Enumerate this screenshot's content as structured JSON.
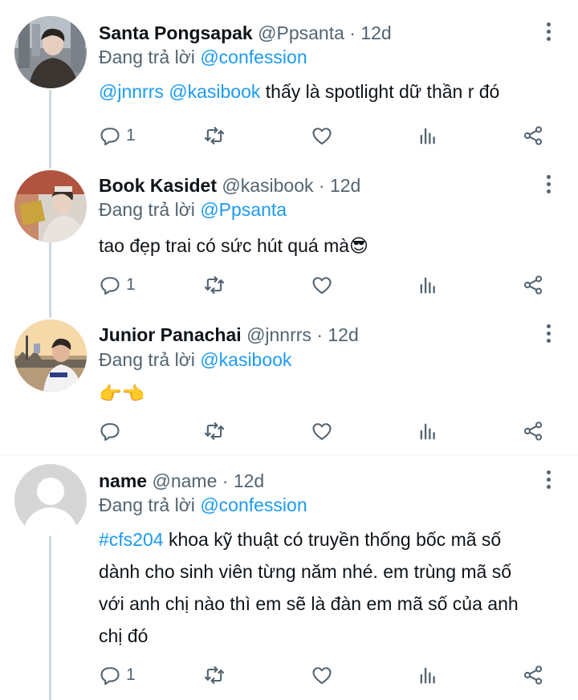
{
  "tweets": [
    {
      "name": "Santa Pongsapak",
      "handle": "@Ppsanta",
      "sep": "·",
      "time": "12d",
      "reply_prefix": "Đang trả lời",
      "reply_to": "@confession",
      "text_parts": {
        "m1": "@jnnrrs",
        "m2": "@kasibook",
        "rest": "thấy là spotlight dữ thần r đó"
      },
      "reply_count": "1"
    },
    {
      "name": "Book Kasidet",
      "handle": "@kasibook",
      "sep": "·",
      "time": "12d",
      "reply_prefix": "Đang trả lời",
      "reply_to": "@Ppsanta",
      "text": "tao đẹp trai có sức hút quá mà😎",
      "reply_count": "1"
    },
    {
      "name": "Junior Panachai",
      "handle": "@jnnrrs",
      "sep": "·",
      "time": "12d",
      "reply_prefix": "Đang trả lời",
      "reply_to": "@kasibook",
      "text": "👉👈"
    },
    {
      "name": "name",
      "handle": "@name",
      "sep": "·",
      "time": "12d",
      "reply_prefix": "Đang trả lời",
      "reply_to": "@confession",
      "hashtag": "#cfs204",
      "line1": "khoa kỹ thuật có truyền thống bốc mã số",
      "line2": "dành cho sinh viên từng năm nhé.  em trùng mã số",
      "line3": "với anh chị nào thì em sẽ là đàn em mã số của anh",
      "line4": "chị đó",
      "reply_count": "1"
    }
  ],
  "icons": {
    "reply": "comment-icon",
    "retweet": "retweet-icon",
    "like": "heart-icon",
    "views": "bar-chart-icon",
    "share": "share-icon",
    "more": "more-vertical-icon"
  },
  "colors": {
    "accent": "#1d9bf0",
    "muted": "#536471",
    "text": "#0f1419",
    "thread_line": "#cfd9de"
  }
}
